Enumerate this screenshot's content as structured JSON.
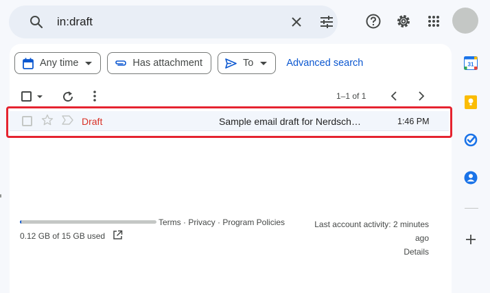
{
  "search": {
    "query": "in:draft"
  },
  "filters": {
    "any_time": "Any time",
    "has_attachment": "Has attachment",
    "to": "To",
    "advanced_search": "Advanced search"
  },
  "toolbar": {
    "pagination": "1–1 of 1"
  },
  "emails": [
    {
      "sender": "Draft",
      "subject": "Sample email draft for Nerdsch…",
      "time": "1:46 PM"
    }
  ],
  "footer": {
    "storage_used": "0.12 GB of 15 GB used",
    "storage_fraction": 0.008,
    "links": "Terms · Privacy · Program Policies",
    "activity_line1": "Last account activity: 2 minutes",
    "activity_line2": "ago",
    "details": "Details"
  },
  "side_panel": {
    "calendar_day": "31"
  },
  "colors": {
    "accent": "#0b57d0",
    "draft_label": "#d93025",
    "highlight": "#e5232f"
  }
}
